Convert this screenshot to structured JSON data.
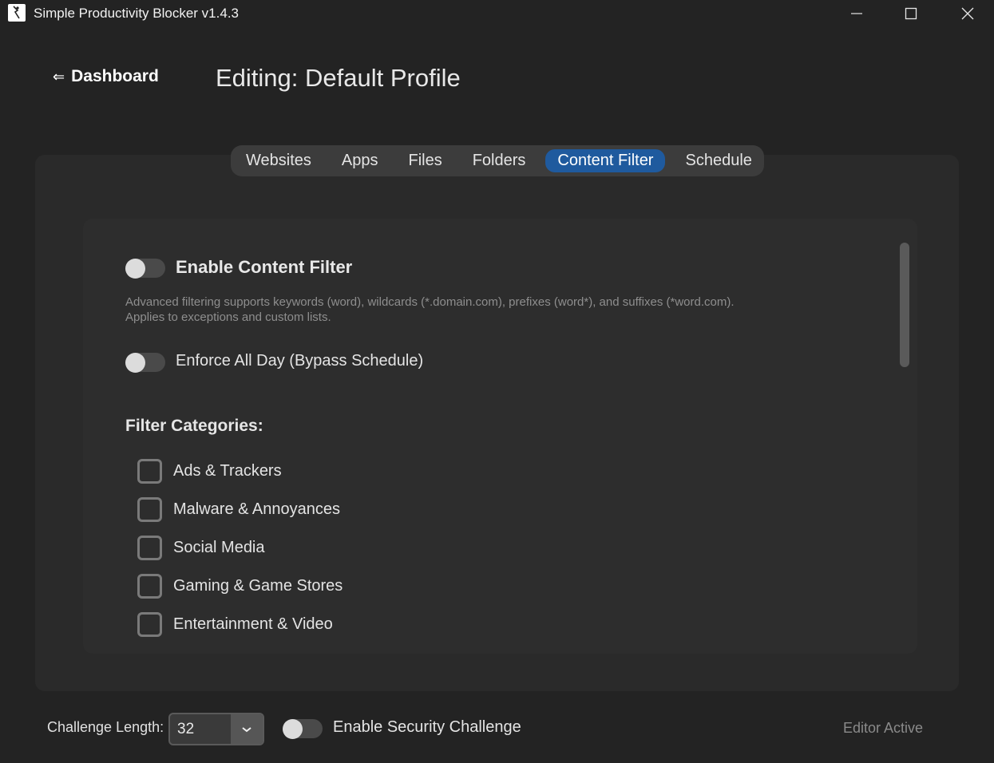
{
  "window": {
    "title": "Simple Productivity Blocker v1.4.3",
    "icon": "app-logo-icon",
    "controls": [
      "minimize-icon",
      "maximize-icon",
      "close-icon"
    ]
  },
  "header": {
    "back_icon": "arrow-left-icon",
    "back_label": "Dashboard",
    "page_title": "Editing: Default Profile"
  },
  "tabs": [
    {
      "label": "Websites",
      "active": false
    },
    {
      "label": "Apps",
      "active": false
    },
    {
      "label": "Files",
      "active": false
    },
    {
      "label": "Folders",
      "active": false
    },
    {
      "label": "Content Filter",
      "active": true
    },
    {
      "label": "Schedule",
      "active": false
    }
  ],
  "content_filter": {
    "enable_label": "Enable Content Filter",
    "enable_on": false,
    "hint_line1": "Advanced filtering supports keywords (word), wildcards (*.domain.com), prefixes (word*), and suffixes (*word.com).",
    "hint_line2": "Applies to exceptions and custom lists.",
    "enforce_label": "Enforce All Day (Bypass Schedule)",
    "enforce_on": false,
    "categories_title": "Filter Categories:",
    "categories": [
      {
        "label": "Ads & Trackers",
        "checked": false
      },
      {
        "label": "Malware & Annoyances",
        "checked": false
      },
      {
        "label": "Social Media",
        "checked": false
      },
      {
        "label": "Gaming & Game Stores",
        "checked": false
      },
      {
        "label": "Entertainment & Video",
        "checked": false
      }
    ]
  },
  "footer": {
    "challenge_label": "Challenge Length:",
    "challenge_value": "32",
    "dropdown_icon": "chevron-down-icon",
    "security_label": "Enable Security Challenge",
    "security_on": false,
    "status": "Editor Active"
  },
  "colors": {
    "background": "#232323",
    "panel": "#2a2a2a",
    "accent": "#1f5a9e",
    "muted_text": "#8e8e8e"
  }
}
